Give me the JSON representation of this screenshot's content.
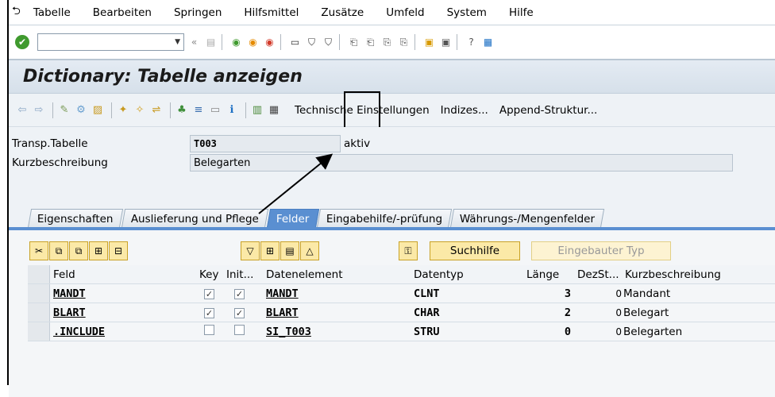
{
  "menu": {
    "exit_glyph": "⮌",
    "items": [
      "Tabelle",
      "Bearbeiten",
      "Springen",
      "Hilfsmittel",
      "Zusätze",
      "Umfeld",
      "System",
      "Hilfe"
    ]
  },
  "toolbar": {
    "command_value": "",
    "back_chevrons": "«"
  },
  "page_title": "Dictionary: Tabelle anzeigen",
  "app_toolbar": {
    "buttons": [
      "Technische Einstellungen",
      "Indizes...",
      "Append-Struktur..."
    ]
  },
  "header": {
    "transp_label": "Transp.Tabelle",
    "transp_value": "T003",
    "status": "aktiv",
    "kurz_label": "Kurzbeschreibung",
    "kurz_value": "Belegarten"
  },
  "tabs": [
    "Eigenschaften",
    "Auslieferung und Pflege",
    "Felder",
    "Eingabehilfe/-prüfung",
    "Währungs-/Mengenfelder"
  ],
  "active_tab": "Felder",
  "tab_toolbar": {
    "suchhilfe": "Suchhilfe",
    "eingebauter_typ": "Eingebauter Typ"
  },
  "table": {
    "columns": [
      "Feld",
      "Key",
      "Init...",
      "Datenelement",
      "Datentyp",
      "Länge",
      "DezSt...",
      "Kurzbeschreibung"
    ],
    "rows": [
      {
        "feld": "MANDT",
        "key": true,
        "init": true,
        "datenelement": "MANDT",
        "datentyp": "CLNT",
        "laenge": "3",
        "dezst": "0",
        "kurz": "Mandant"
      },
      {
        "feld": "BLART",
        "key": true,
        "init": true,
        "datenelement": "BLART",
        "datentyp": "CHAR",
        "laenge": "2",
        "dezst": "0",
        "kurz": "Belegart"
      },
      {
        "feld": ".INCLUDE",
        "key": false,
        "init": false,
        "datenelement": "SI_T003",
        "datentyp": "STRU",
        "laenge": "0",
        "dezst": "0",
        "kurz": "Belegarten"
      }
    ]
  },
  "colors": {
    "accent_tab": "#5a8fd1",
    "ok_green": "#3f9a2e",
    "button_yellow": "#fbe9a7"
  }
}
